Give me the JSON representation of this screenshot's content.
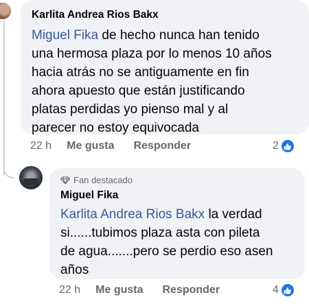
{
  "comment": {
    "author": "Karlita Andrea Rios Bakx",
    "mention": "Miguel Fika",
    "text_line1_rest": " de hecho nunca han tenido",
    "text_lines": [
      "una hermosa plaza por lo menos 10 años",
      "hacia atrás  no se antiguamente en fin",
      "ahora apuesto que están justificando",
      "platas perdidas  yo pienso mal y al",
      "parecer no estoy equivocada"
    ],
    "time": "22 h",
    "like_label": "Me gusta",
    "reply_label": "Responder",
    "reaction_count": "2"
  },
  "reply": {
    "badge": "Fan destacado",
    "author": "Miguel Fika",
    "mention": "Karlita Andrea Rios Bakx",
    "text_line1_rest": " la verdad",
    "text_lines": [
      "si......tubimos plaza asta con pileta",
      "de agua.......pero se perdio eso asen",
      "años"
    ],
    "time": "22 h",
    "like_label": "Me gusta",
    "reply_label": "Responder",
    "reaction_count": "4"
  },
  "colors": {
    "bubble": "#f0f2f5",
    "mention": "#385898",
    "secondary_text": "#65676b",
    "like_blue": "#1b74e4"
  }
}
